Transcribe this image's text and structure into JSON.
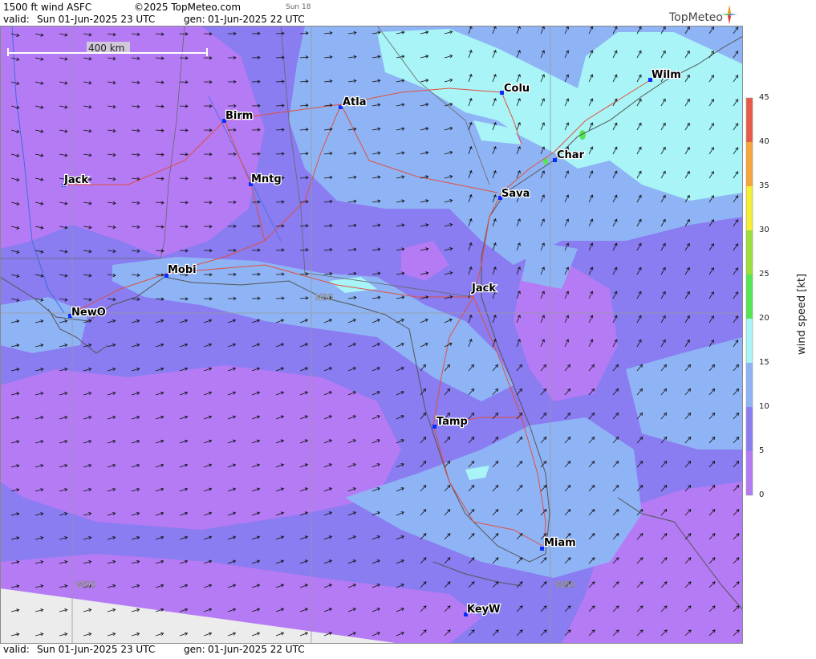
{
  "header": {
    "product": "1500 ft wind ASFC",
    "copyright": "©2025 TopMeteo.com",
    "day_code": "Sun 18",
    "valid_label": "valid:",
    "valid_value": "Sun  01-Jun-2025  23 UTC",
    "gen_label": "gen:",
    "gen_value": "01-Jun-2025 22 UTC",
    "logo_text": "TopMeteo",
    "logo_icon": "compass-star-icon"
  },
  "footer": {
    "valid_label": "valid:",
    "valid_value": "Sun  01-Jun-2025  23 UTC",
    "gen_label": "gen:",
    "gen_value": "01-Jun-2025 22 UTC"
  },
  "scale_bar": {
    "label": "400 km"
  },
  "grid_labels": [
    "N30",
    "W90",
    "W80"
  ],
  "cities": [
    {
      "name": "NewO"
    },
    {
      "name": "Jack"
    },
    {
      "name": "Mobi"
    },
    {
      "name": "Birm"
    },
    {
      "name": "Mntg"
    },
    {
      "name": "Atla"
    },
    {
      "name": "Colu"
    },
    {
      "name": "Wilm"
    },
    {
      "name": "Char"
    },
    {
      "name": "Sava"
    },
    {
      "name": "Jack"
    },
    {
      "name": "Tamp"
    },
    {
      "name": "Miam"
    },
    {
      "name": "KeyW"
    }
  ],
  "colorbar": {
    "title": "wind speed [kt]",
    "ticks": [
      "45",
      "40",
      "35",
      "30",
      "25",
      "20",
      "15",
      "10",
      "5",
      "0"
    ],
    "colors": {
      "0-5": "#b57bf5",
      "5-10": "#8a7cf1",
      "10-15": "#8fb4f5",
      "15-20": "#a8f4f6",
      "20-25": "#55e655",
      "25-30": "#9adf3a",
      "30-35": "#f2ef34",
      "35-40": "#f5a53a",
      "40-45": "#e85a48"
    }
  },
  "colors": {
    "coast": "#555555",
    "roads": "#e05040",
    "rivers": "#3a6fe0",
    "nodata": "#ececec"
  }
}
